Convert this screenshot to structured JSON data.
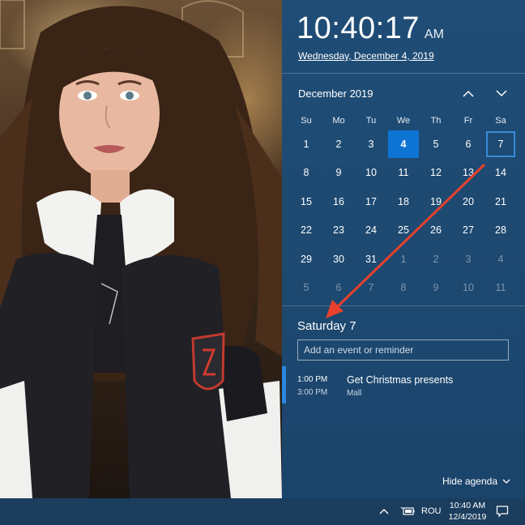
{
  "clock": {
    "time": "10:40:17",
    "ampm": "AM",
    "date_long": "Wednesday, December 4, 2019"
  },
  "calendar": {
    "month_label": "December 2019",
    "weekdays": [
      "Su",
      "Mo",
      "Tu",
      "We",
      "Th",
      "Fr",
      "Sa"
    ],
    "weeks": [
      [
        "1",
        "2",
        "3",
        "4",
        "5",
        "6",
        "7"
      ],
      [
        "8",
        "9",
        "10",
        "11",
        "12",
        "13",
        "14"
      ],
      [
        "15",
        "16",
        "17",
        "18",
        "19",
        "20",
        "21"
      ],
      [
        "22",
        "23",
        "24",
        "25",
        "26",
        "27",
        "28"
      ],
      [
        "29",
        "30",
        "31",
        "1",
        "2",
        "3",
        "4"
      ],
      [
        "5",
        "6",
        "7",
        "8",
        "9",
        "10",
        "11"
      ]
    ],
    "today": "4",
    "selected": "7"
  },
  "agenda": {
    "title": "Saturday 7",
    "input_placeholder": "Add an event or reminder",
    "events": [
      {
        "start": "1:00 PM",
        "end": "3:00 PM",
        "title": "Get Christmas presents",
        "location": "Mall"
      }
    ],
    "hide_label": "Hide agenda"
  },
  "taskbar": {
    "language": "ROU",
    "time": "10:40 AM",
    "date": "12/4/2019"
  },
  "colors": {
    "flyout_bg": "#1e4a72",
    "accent": "#0d74d4",
    "annotation_arrow": "#e8412c",
    "taskbar_bg": "#1b3d5e"
  },
  "icons": {
    "prev_month": "chevron-up-icon",
    "next_month": "chevron-down-icon",
    "hide_agenda": "chevron-down-icon",
    "tray_overflow": "chevron-up-icon",
    "tray_battery": "battery-icon",
    "tray_notifications": "notification-icon"
  }
}
